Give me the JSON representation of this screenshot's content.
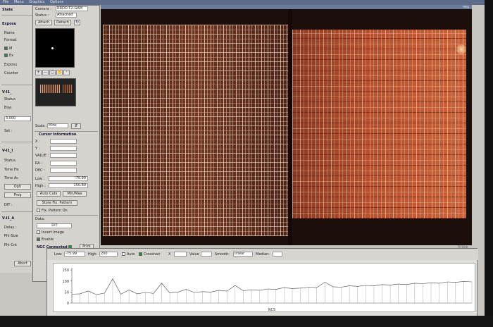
{
  "menubar": {
    "items": [
      "File",
      "Menu",
      "Graphics",
      "Options"
    ]
  },
  "left_panel": {
    "title": "State",
    "exposure_heading": "Exposu",
    "name_label": "Name",
    "format_label": "Format",
    "check1_label": "M",
    "check2_label": "Ex",
    "exposure_label": "Exposu",
    "counter_label": "Counter",
    "vifi_label1": "V-I1_",
    "status_label": "Status",
    "bias_label": "Bias",
    "set_label": "Set :",
    "value_3000": "3,000",
    "vifi_label2": "V-I1_I",
    "status_label2": "Status",
    "time_fix_label": "Time Fix",
    "time_act_label": "Time Ac",
    "btn_opt": "Opti",
    "btn_prog": "Prog",
    "dit_label": "DIT :",
    "vifi_label3": "V-I1_A",
    "delay_label": "Delay :",
    "ph_size_label": "Phl-Size",
    "ph_cnt_label": "Phl-Cnt",
    "abort_label": "Abort"
  },
  "mid_panel": {
    "camera_label": "Camera :",
    "camera_value": "RRDO-T2-GAM",
    "status_label": "Status :",
    "status_value": "Attached",
    "attach_label": "Attach",
    "detach_label": "Detach",
    "scale_label": "Scale :",
    "scale_value": "Minc",
    "cursor_heading": "Cursor Information",
    "x_label": "X :",
    "y_label": "Y :",
    "value_label": "VALUE :",
    "ra_label": "RA :",
    "dec_label": "DEC :",
    "low_label": "Low :",
    "low_value": "-75.99",
    "high_label": "High :",
    "high_value": "150.89",
    "auto_cuts_label": "Auto Cuts",
    "minmax_label": "Min/Max",
    "store_fix_label": "Store Fix. Pattern",
    "fix_pattern_on_label": "Fix. Pattern On",
    "data_label": "Data:",
    "data_value": "DIT",
    "invert_label": "Invert Image",
    "enable_label": "Enable",
    "ngc_label": "NGC Connected",
    "print_label": "Print"
  },
  "display": {
    "title_right": "Help",
    "status_right": "FIFO08"
  },
  "plot_toolbar": {
    "low_label": "Low:",
    "low_value": "-75.99",
    "high_label": "High:",
    "high_value": "200",
    "auto_label": "Auto",
    "crosshair_label": "Crosshair",
    "x_label": "X",
    "value_label": "Value",
    "smooth_label": "Smooth:",
    "smooth_value": "linear",
    "median_label": "Median:"
  },
  "plot": {
    "y_ticks": [
      "150",
      "100",
      "50",
      "0"
    ],
    "x_label": "NCS"
  },
  "colors": {
    "menubar": "#5d6c8a",
    "ngc_led": "#2b8a3e",
    "frame_right": "#c86238"
  },
  "chart_data": {
    "type": "line",
    "ylim": [
      0,
      160
    ],
    "yticks": [
      0,
      50,
      100,
      150
    ],
    "xlabel": "NCS",
    "ylabel": "",
    "grid": false,
    "legend": "none",
    "series": [
      {
        "values": [
          40,
          42,
          55,
          38,
          45,
          110,
          40,
          60,
          42,
          48,
          44,
          90,
          46,
          50,
          62,
          48,
          52,
          50,
          58,
          54,
          80,
          56,
          60,
          58,
          64,
          62,
          70,
          66,
          68,
          72,
          70,
          95,
          74,
          72,
          78,
          76,
          80,
          78,
          84,
          82,
          86,
          84,
          90,
          88,
          92,
          90,
          96,
          94,
          98,
          96
        ]
      }
    ]
  }
}
